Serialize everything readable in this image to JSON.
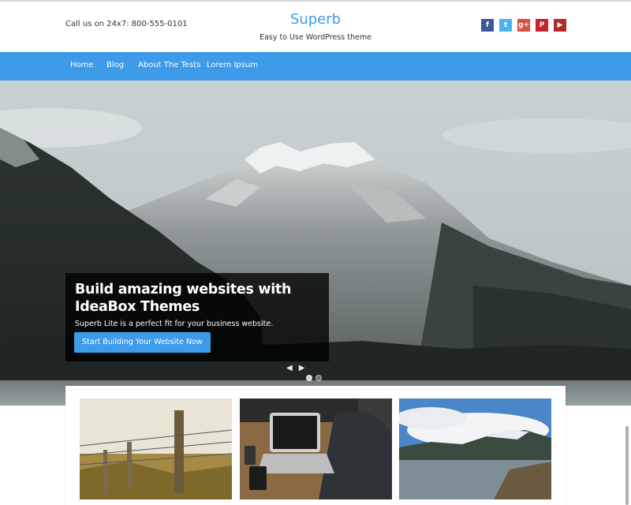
{
  "header": {
    "phone": "Call us on 24x7: 800-555-0101",
    "site_title": "Superb",
    "tagline": "Easy to Use WordPress theme",
    "socials": [
      {
        "name": "facebook-icon",
        "glyph": "f",
        "color": "#3b5998"
      },
      {
        "name": "twitter-icon",
        "glyph": "t",
        "color": "#4db3ec"
      },
      {
        "name": "google-plus-icon",
        "glyph": "g+",
        "color": "#dc4e41"
      },
      {
        "name": "pinterest-icon",
        "glyph": "P",
        "color": "#c8232c"
      },
      {
        "name": "youtube-icon",
        "glyph": "▶",
        "color": "#b52a2a"
      }
    ]
  },
  "nav": {
    "items": [
      "Home",
      "Blog",
      "About The Tests",
      "Lorem Ipsum"
    ]
  },
  "hero": {
    "headline": "Build amazing websites with IdeaBox Themes",
    "subtext": "Superb Lite is a perfect fit for your business website.",
    "cta_label": "Start Building Your Website Now",
    "prev_arrow": "◀",
    "next_arrow": "▶"
  },
  "theme": {
    "accent": "#3d9be9"
  }
}
